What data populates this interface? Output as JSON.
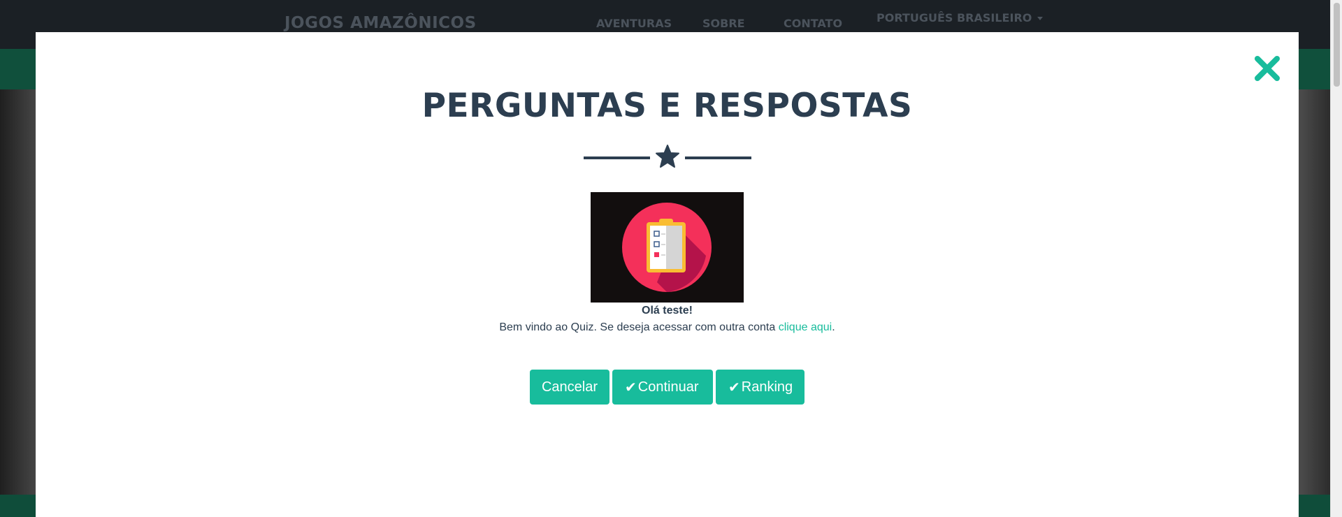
{
  "navbar": {
    "brand": "JOGOS AMAZÔNICOS",
    "links": [
      "AVENTURAS",
      "SOBRE",
      "CONTATO"
    ],
    "language": "PORTUGUÊS BRASILEIRO"
  },
  "modal": {
    "title": "PERGUNTAS E RESPOSTAS",
    "image_icon": "clipboard-checklist-icon",
    "greeting": "Olá teste!",
    "welcome_text": "Bem vindo ao Quiz. Se deseja acessar com outra conta",
    "welcome_link": "clique aqui",
    "welcome_end": ".",
    "buttons": {
      "cancel": "Cancelar",
      "continue": "Continuar",
      "ranking": "Ranking"
    }
  },
  "colors": {
    "primary": "#2c3e50",
    "accent": "#18bc9c"
  }
}
